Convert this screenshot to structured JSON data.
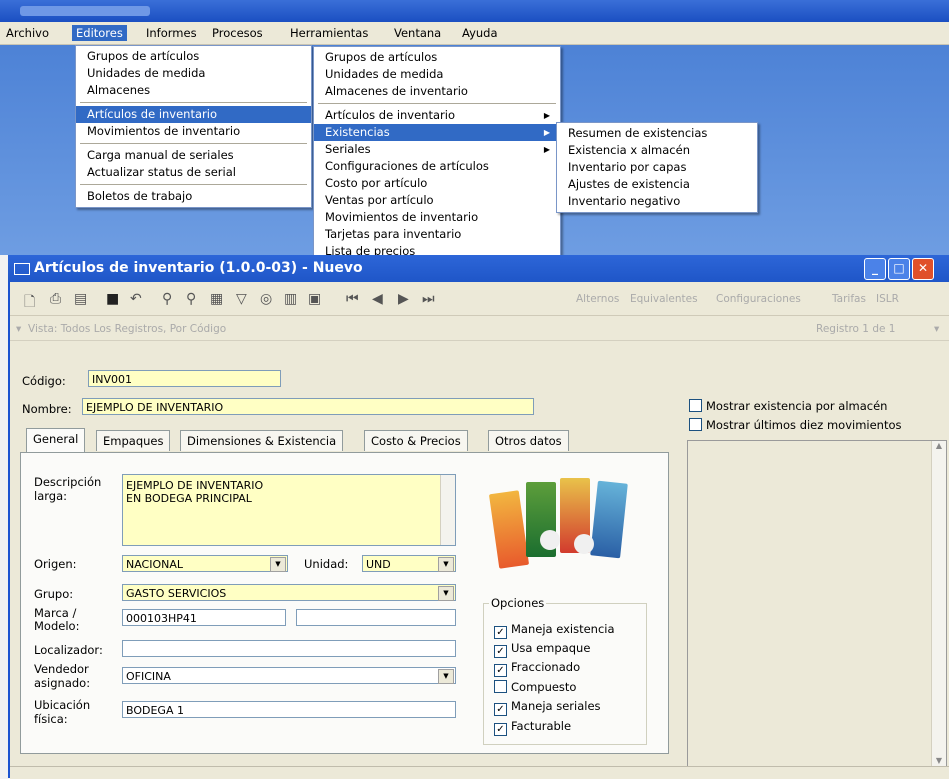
{
  "menubar": {
    "items": [
      "Archivo",
      "Editores",
      "Informes",
      "Procesos",
      "Herramientas",
      "Ventana",
      "Ayuda"
    ],
    "active": "Editores"
  },
  "menu1": {
    "items": [
      "Grupos de artículos",
      "Unidades de medida",
      "Almacenes",
      "Artículos de inventario",
      "Movimientos de inventario",
      "Carga manual de seriales",
      "Actualizar status de serial",
      "Boletos de trabajo"
    ],
    "selected": "Artículos de inventario"
  },
  "menu2": {
    "items": [
      "Grupos de artículos",
      "Unidades de medida",
      "Almacenes de inventario",
      "Artículos de inventario",
      "Existencias",
      "Seriales",
      "Configuraciones de artículos",
      "Costo por artículo",
      "Ventas por artículo",
      "Movimientos de inventario",
      "Tarjetas para inventario",
      "Lista de precios"
    ],
    "selected": "Existencias"
  },
  "menu3": {
    "items": [
      "Resumen de existencias",
      "Existencia x almacén",
      "Inventario por capas",
      "Ajustes de existencia",
      "Inventario negativo"
    ]
  },
  "window": {
    "title": "Artículos de inventario (1.0.0-03) - Nuevo"
  },
  "toolbar": {
    "links": [
      "Alternos",
      "Equivalentes",
      "Configuraciones",
      "Tarifas",
      "ISLR"
    ]
  },
  "vista": {
    "label": "Vista: Todos Los Registros, Por Código",
    "record": "Registro 1 de 1"
  },
  "form": {
    "codigo_label": "Código:",
    "codigo_value": "INV001",
    "nombre_label": "Nombre:",
    "nombre_value": "EJEMPLO DE INVENTARIO",
    "descripcion_label1": "Descripción",
    "descripcion_label2": "larga:",
    "descripcion_line1": "EJEMPLO DE INVENTARIO",
    "descripcion_line2": "EN BODEGA PRINCIPAL",
    "origen_label": "Origen:",
    "origen_value": "NACIONAL",
    "unidad_label": "Unidad:",
    "unidad_value": "UND",
    "grupo_label": "Grupo:",
    "grupo_value": "GASTO SERVICIOS",
    "marca_label1": "Marca /",
    "marca_label2": "Modelo:",
    "marca_value": "000103HP41",
    "modelo_value": "",
    "localizador_label": "Localizador:",
    "localizador_value": "",
    "vendedor_label1": "Vendedor",
    "vendedor_label2": "asignado:",
    "vendedor_value": "OFICINA",
    "ubicacion_label1": "Ubicación",
    "ubicacion_label2": "física:",
    "ubicacion_value": "BODEGA 1"
  },
  "tabs": [
    "General",
    "Empaques",
    "Dimensiones & Existencia",
    "Costo & Precios",
    "Otros datos"
  ],
  "opciones": {
    "title": "Opciones",
    "items": [
      {
        "label": "Maneja existencia",
        "checked": true
      },
      {
        "label": "Usa empaque",
        "checked": true
      },
      {
        "label": "Fraccionado",
        "checked": true
      },
      {
        "label": "Compuesto",
        "checked": false
      },
      {
        "label": "Maneja seriales",
        "checked": true
      },
      {
        "label": "Facturable",
        "checked": true
      }
    ]
  },
  "right_options": [
    {
      "label": "Mostrar existencia por almacén",
      "checked": false
    },
    {
      "label": "Mostrar últimos diez movimientos",
      "checked": false
    }
  ],
  "colors": {
    "selection": "#316ac5",
    "title_blue": "#1f56c8",
    "field_yellow": "#ffffc4"
  }
}
